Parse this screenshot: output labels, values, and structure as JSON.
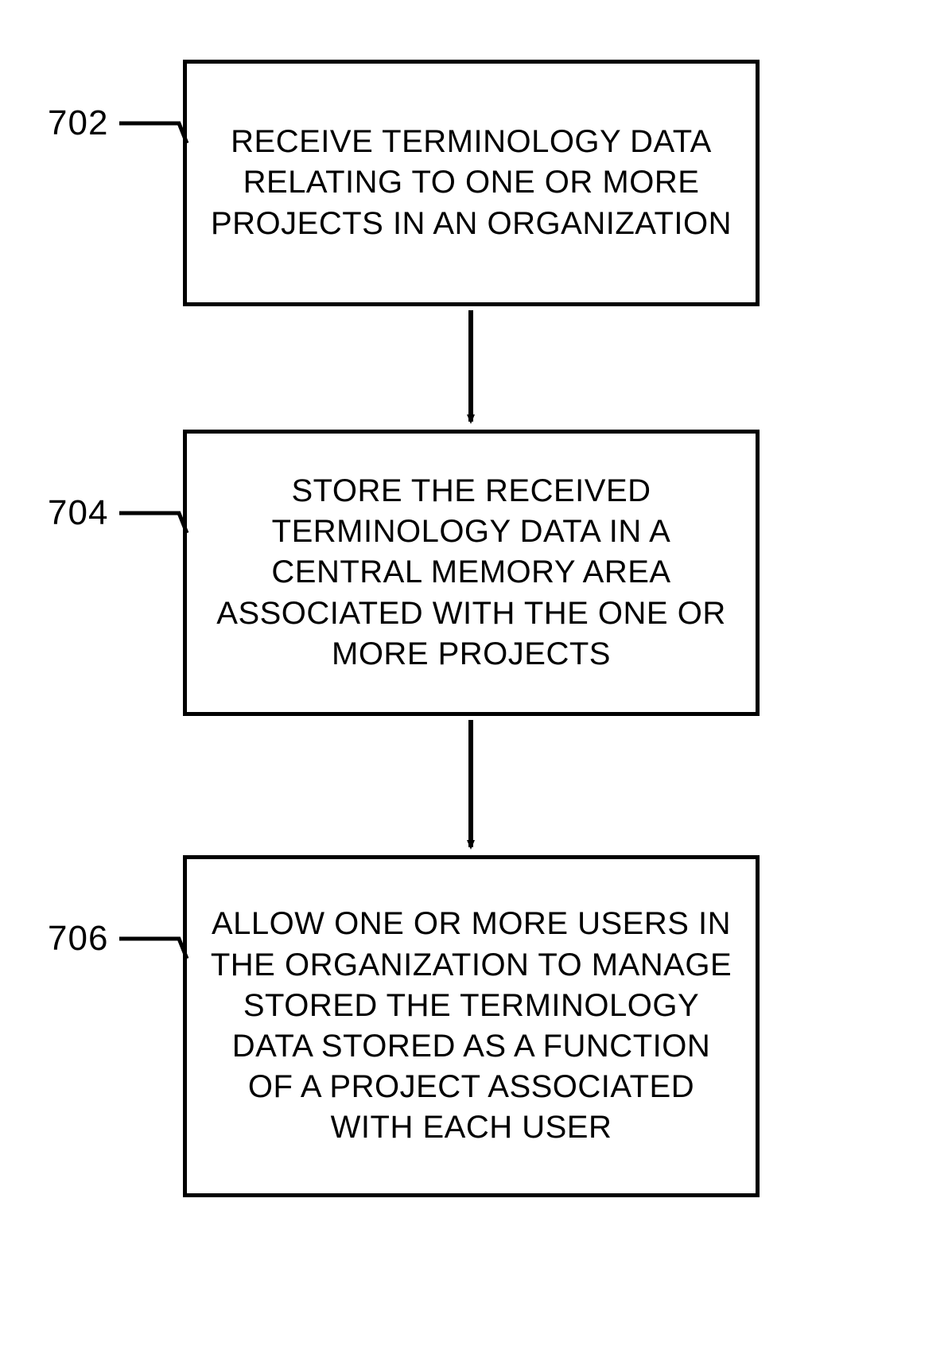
{
  "chart_data": {
    "type": "flowchart",
    "nodes": [
      {
        "id": "702",
        "label": "702",
        "text": "RECEIVE TERMINOLOGY DATA RELATING TO ONE OR MORE PROJECTS IN AN ORGANIZATION"
      },
      {
        "id": "704",
        "label": "704",
        "text": "STORE THE RECEIVED TERMINOLOGY DATA IN A CENTRAL MEMORY AREA ASSOCIATED WITH THE ONE OR MORE PROJECTS"
      },
      {
        "id": "706",
        "label": "706",
        "text": "ALLOW ONE OR MORE USERS IN THE ORGANIZATION TO MANAGE STORED THE TERMINOLOGY DATA STORED AS A FUNCTION OF A PROJECT ASSOCIATED WITH EACH USER"
      }
    ],
    "edges": [
      {
        "from": "702",
        "to": "704"
      },
      {
        "from": "704",
        "to": "706"
      }
    ]
  }
}
